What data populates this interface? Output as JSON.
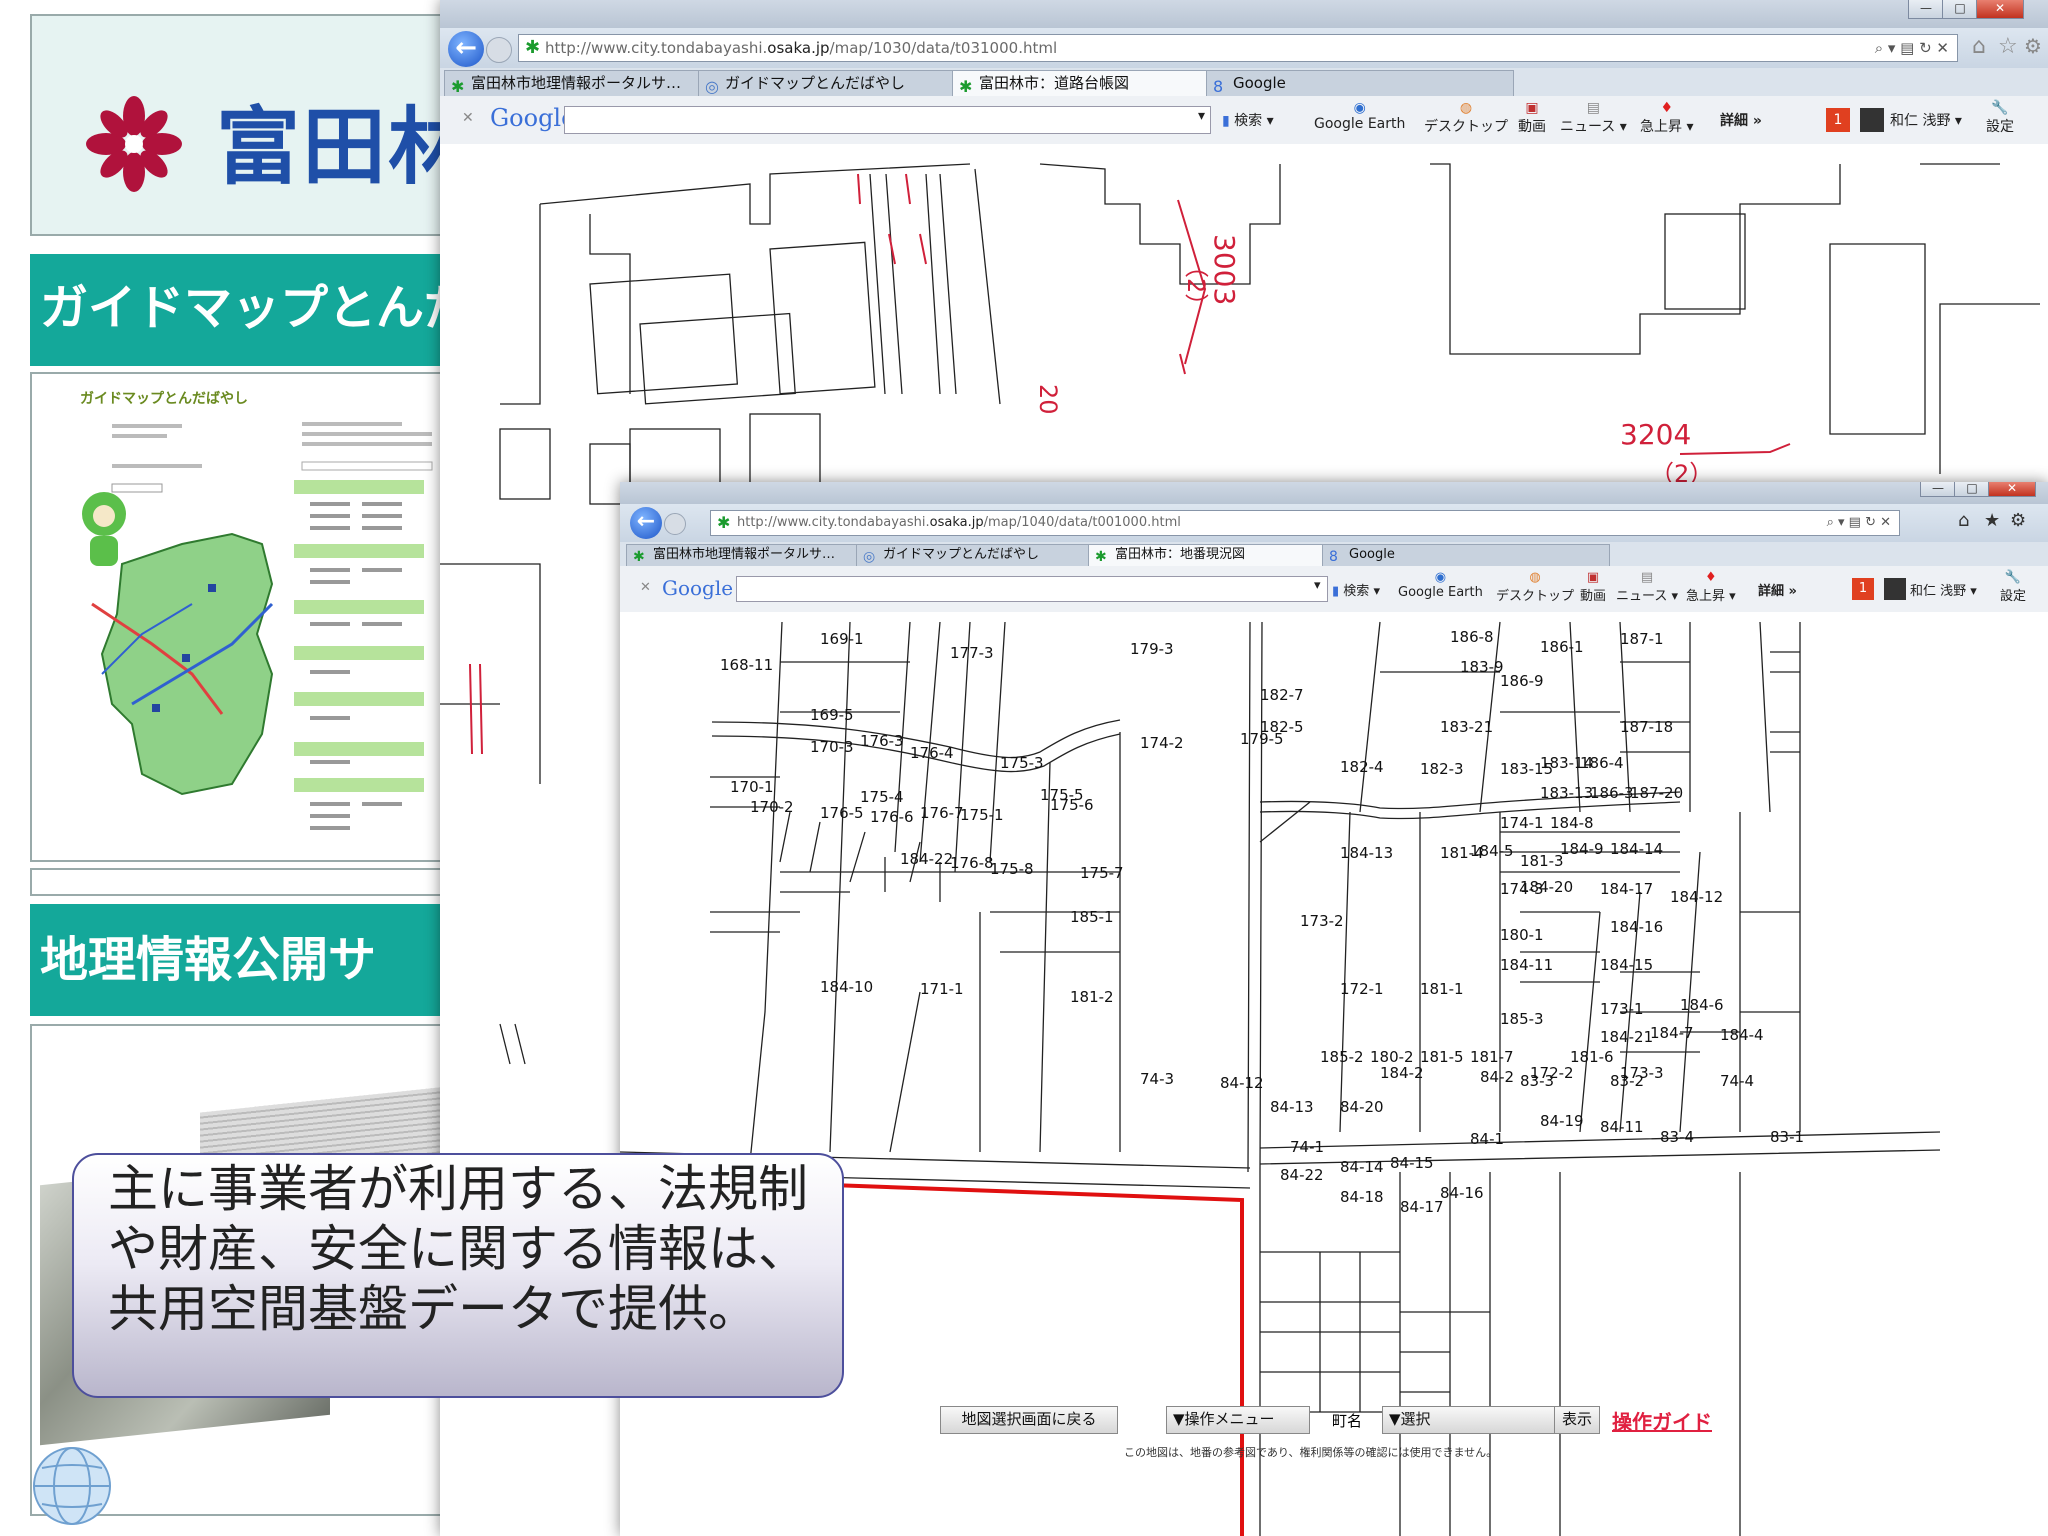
{
  "left_slide": {
    "city_title": "富田林",
    "banner1": "ガイドマップとんだ",
    "banner2": "地理情報公開サ",
    "thumb_title": "ガイドマップとんだばやし"
  },
  "callout": {
    "text": "主に事業者が利用する、法規制や財産、安全に関する情報は、共用空間基盤データで提供。"
  },
  "window_back": {
    "url_prefix": "http://www.city.tondabayashi.",
    "url_domain": "osaka.jp",
    "url_suffix": "/map/1030/data/t031000.html",
    "tabs": [
      {
        "label": "富田林市地理情報ポータルサ…",
        "active": false
      },
      {
        "label": "ガイドマップとんだばやし",
        "active": false
      },
      {
        "label": "富田林市：道路台帳図",
        "active": true
      },
      {
        "label": "Google",
        "active": false
      }
    ],
    "map_labels": [
      {
        "text": "3003"
      },
      {
        "text": "（2）"
      },
      {
        "text": "20"
      },
      {
        "text": "3204"
      },
      {
        "text": "（2）"
      }
    ]
  },
  "window_front": {
    "url_prefix": "http://www.city.tondabayashi.",
    "url_domain": "osaka.jp",
    "url_suffix": "/map/1040/data/t001000.html",
    "tabs": [
      {
        "label": "富田林市地理情報ポータルサ…",
        "active": false
      },
      {
        "label": "ガイドマップとんだばやし",
        "active": false
      },
      {
        "label": "富田林市：地番現況図",
        "active": true
      },
      {
        "label": "Google",
        "active": false
      }
    ],
    "parcels": [
      "169-1",
      "177-3",
      "179-3",
      "186-8",
      "186-1",
      "187-1",
      "168-11",
      "169-5",
      "182-7",
      "183-9",
      "186-9",
      "182-5",
      "183-21",
      "187-18",
      "170-3",
      "176-3",
      "176-4",
      "175-3",
      "174-2",
      "179-5",
      "182-4",
      "182-3",
      "183-15",
      "183-14",
      "186-4",
      "170-1",
      "175-4",
      "175-5",
      "183-13",
      "186-3",
      "187-20",
      "170-2",
      "176-5",
      "176-6",
      "176-7",
      "175-1",
      "175-6",
      "174-1",
      "184-8",
      "184-5",
      "184-9",
      "184-14",
      "184-13",
      "181-4",
      "181-3",
      "184-20",
      "184-22",
      "176-8",
      "175-8",
      "175-7",
      "174-3",
      "184-17",
      "184-12",
      "185-1",
      "173-2",
      "180-1",
      "184-16",
      "184-11",
      "184-15",
      "184-10",
      "171-1",
      "172-1",
      "181-1",
      "181-2",
      "173-1",
      "184-6",
      "185-3",
      "184-21",
      "184-7",
      "184-4",
      "185-2",
      "180-2",
      "181-5",
      "181-7",
      "181-6",
      "184-2",
      "172-2",
      "173-3",
      "84-2",
      "83-3",
      "83-2",
      "74-4",
      "74-3",
      "84-12",
      "84-13",
      "84-20",
      "84-1",
      "84-19",
      "84-11",
      "83-4",
      "83-1",
      "74-1",
      "84-14",
      "84-15",
      "84-22",
      "84-18",
      "84-16",
      "84-17"
    ]
  },
  "toolbar": {
    "google_label": "Google",
    "search_label": "検索",
    "earth_label": "Google Earth",
    "desktop_label": "デスクトップ",
    "video_label": "動画",
    "news_label": "ニュース",
    "trend_label": "急上昇",
    "more_label": "詳細 »",
    "user_label": "和仁 浅野",
    "settings_label": "設定"
  },
  "map_controls": {
    "back_button": "地図選択画面に戻る",
    "op_menu": "▼操作メニュー",
    "town_label": "町名",
    "town_select": "▼選択",
    "show_button": "表示",
    "guide_link": "操作ガイド",
    "disclaimer": "この地図は、地番の参考図であり、権利関係等の確認には使用できません。"
  },
  "colors": {
    "teal": "#14a89a",
    "title_blue": "#1f4fa8",
    "logo_red": "#b0123c",
    "road_red": "#e01010",
    "map_red": "#d0203a"
  }
}
